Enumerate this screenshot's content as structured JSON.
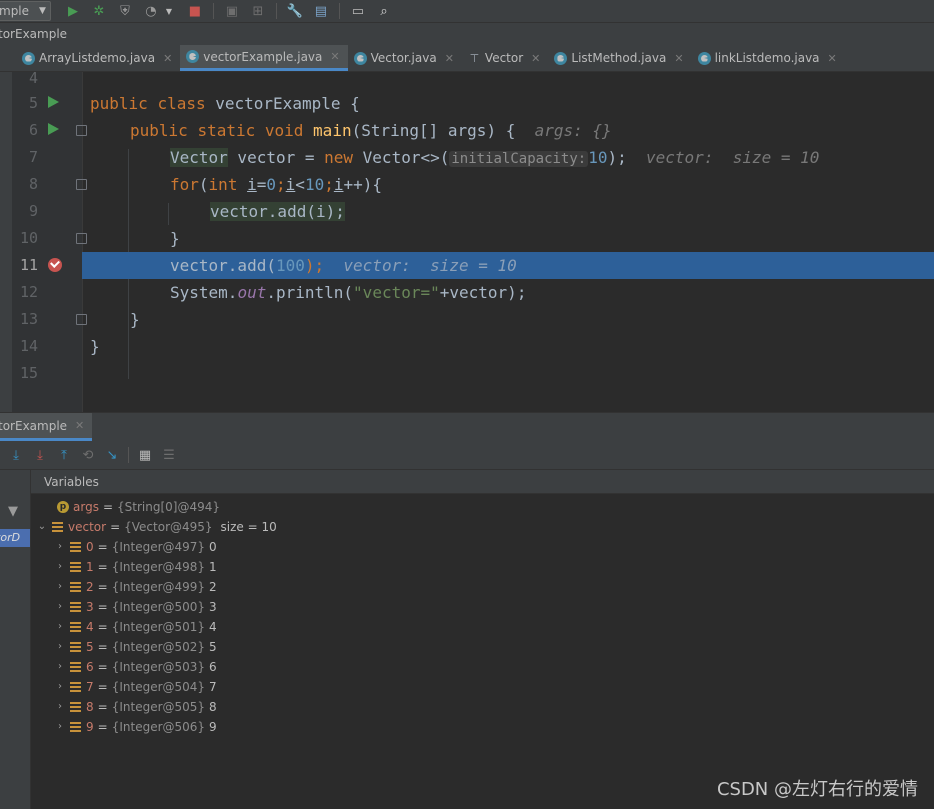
{
  "toolbar": {
    "run_config": "mple",
    "icons": [
      "run-icon",
      "debug-icon",
      "coverage-icon",
      "profile-icon",
      "stop-icon",
      "build-icon",
      "settings-icon",
      "structure-icon",
      "frame-icon",
      "search-icon"
    ]
  },
  "breadcrumb": "torExample",
  "tabs": [
    {
      "label": "ArrayListdemo.java",
      "active": false,
      "icon": "class"
    },
    {
      "label": "vectorExample.java",
      "active": true,
      "icon": "class"
    },
    {
      "label": "Vector.java",
      "active": false,
      "icon": "class"
    },
    {
      "label": "Vector",
      "active": false,
      "icon": "decompiled"
    },
    {
      "label": "ListMethod.java",
      "active": false,
      "icon": "class"
    },
    {
      "label": "linkListdemo.java",
      "active": false,
      "icon": "class"
    }
  ],
  "editor": {
    "line_numbers": [
      "4",
      "5",
      "6",
      "7",
      "8",
      "9",
      "10",
      "11",
      "12",
      "13",
      "14",
      "15"
    ],
    "current_line": "11",
    "code": {
      "l5": {
        "kw1": "public",
        "kw2": "class",
        "name": "vectorExample",
        "brace": "{"
      },
      "l6": {
        "kw1": "public",
        "kw2": "static",
        "kw3": "void",
        "name": "main",
        "params": "(String[] args) {",
        "hint": "args: {}"
      },
      "l7": {
        "type": "Vector",
        "rest1": " vector = ",
        "kw": "new",
        "rest2": " Vector<>(",
        "param_hint": "initialCapacity:",
        "num": "10",
        "rest3": ");",
        "hint": "vector:  size = 10"
      },
      "l8": {
        "kw1": "for",
        "p1": "(",
        "kw2": "int",
        "sp": " ",
        "var1": "i",
        "p2": "=",
        "n0": "0",
        "p3": ";",
        "var2": "i",
        "p4": "<",
        "n10": "10",
        "p5": ";",
        "var3": "i",
        "p6": "++){"
      },
      "l9": {
        "call": "vector.add(i);"
      },
      "l10": {
        "brace": "}"
      },
      "l11": {
        "call": "vector.add(",
        "num": "100",
        "end": ");",
        "hint": "vector:  size = 10"
      },
      "l12": {
        "a": "System.",
        "field": "out",
        "b": ".println(",
        "str": "\"vector=\"",
        "c": "+vector);"
      },
      "l13": {
        "brace": "}"
      },
      "l14": {
        "brace": "}"
      }
    }
  },
  "debug": {
    "tab_label": "torExample",
    "frame_label": "ctorD",
    "variables_title": "Variables",
    "vars": [
      {
        "name": "args",
        "type": "{String[0]@494}",
        "value": ""
      },
      {
        "name": "vector",
        "type": "{Vector@495}",
        "value": "size = 10"
      }
    ],
    "elements": [
      {
        "name": "0",
        "type": "{Integer@497}",
        "value": "0"
      },
      {
        "name": "1",
        "type": "{Integer@498}",
        "value": "1"
      },
      {
        "name": "2",
        "type": "{Integer@499}",
        "value": "2"
      },
      {
        "name": "3",
        "type": "{Integer@500}",
        "value": "3"
      },
      {
        "name": "4",
        "type": "{Integer@501}",
        "value": "4"
      },
      {
        "name": "5",
        "type": "{Integer@502}",
        "value": "5"
      },
      {
        "name": "6",
        "type": "{Integer@503}",
        "value": "6"
      },
      {
        "name": "7",
        "type": "{Integer@504}",
        "value": "7"
      },
      {
        "name": "8",
        "type": "{Integer@505}",
        "value": "8"
      },
      {
        "name": "9",
        "type": "{Integer@506}",
        "value": "9"
      }
    ]
  },
  "watermark": "CSDN @左灯右行的爱情"
}
